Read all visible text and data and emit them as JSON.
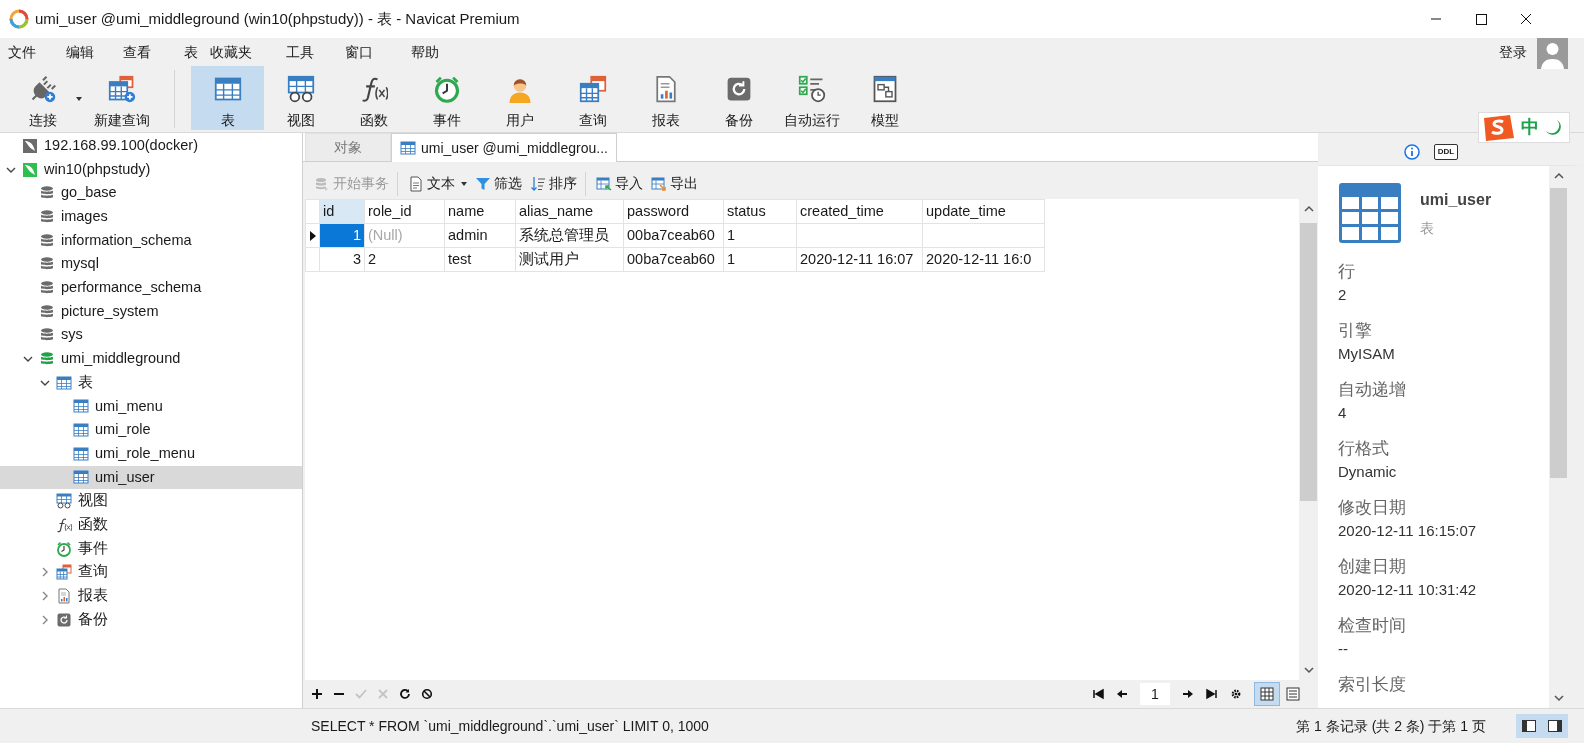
{
  "window": {
    "title": "umi_user @umi_middleground (win10(phpstudy)) - 表 - Navicat Premium"
  },
  "menu": [
    "文件",
    "编辑",
    "查看",
    "表",
    "收藏夹",
    "工具",
    "窗口",
    "帮助"
  ],
  "account": {
    "label": "登录"
  },
  "toolbar": [
    {
      "kind": "connect",
      "label": "连接",
      "selected": false,
      "dropdown": true
    },
    {
      "kind": "new-query",
      "label": "新建查询",
      "selected": false,
      "dropdown": false
    },
    {
      "kind": "table",
      "label": "表",
      "selected": true,
      "dropdown": false
    },
    {
      "kind": "view",
      "label": "视图",
      "selected": false,
      "dropdown": false
    },
    {
      "kind": "function",
      "label": "函数",
      "selected": false,
      "dropdown": false
    },
    {
      "kind": "event",
      "label": "事件",
      "selected": false,
      "dropdown": false
    },
    {
      "kind": "user",
      "label": "用户",
      "selected": false,
      "dropdown": false
    },
    {
      "kind": "query",
      "label": "查询",
      "selected": false,
      "dropdown": false
    },
    {
      "kind": "report",
      "label": "报表",
      "selected": false,
      "dropdown": false
    },
    {
      "kind": "backup",
      "label": "备份",
      "selected": false,
      "dropdown": false
    },
    {
      "kind": "autorun",
      "label": "自动运行",
      "selected": false,
      "dropdown": false
    },
    {
      "kind": "model",
      "label": "模型",
      "selected": false,
      "dropdown": false
    }
  ],
  "tree": [
    {
      "kind": "connection",
      "label": "192.168.99.100(docker)",
      "open": false,
      "selected": false
    },
    {
      "kind": "connection",
      "label": "win10(phpstudy)",
      "open": true,
      "expanded": true,
      "selected": false,
      "children": [
        {
          "kind": "database",
          "label": "go_base",
          "open": false,
          "selected": false
        },
        {
          "kind": "database",
          "label": "images",
          "open": false,
          "selected": false
        },
        {
          "kind": "database",
          "label": "information_schema",
          "open": false,
          "selected": false
        },
        {
          "kind": "database",
          "label": "mysql",
          "open": false,
          "selected": false
        },
        {
          "kind": "database",
          "label": "performance_schema",
          "open": false,
          "selected": false
        },
        {
          "kind": "database",
          "label": "picture_system",
          "open": false,
          "selected": false
        },
        {
          "kind": "database",
          "label": "sys",
          "open": false,
          "selected": false
        },
        {
          "kind": "database",
          "label": "umi_middleground",
          "open": true,
          "expanded": true,
          "selected": false,
          "children": [
            {
              "kind": "table",
              "label": "表",
              "expanded": true,
              "selected": false,
              "children": [
                {
                  "kind": "table",
                  "label": "umi_menu",
                  "selected": false
                },
                {
                  "kind": "table",
                  "label": "umi_role",
                  "selected": false
                },
                {
                  "kind": "table",
                  "label": "umi_role_menu",
                  "selected": false
                },
                {
                  "kind": "table",
                  "label": "umi_user",
                  "selected": true
                }
              ]
            },
            {
              "kind": "view",
              "label": "视图",
              "selected": false
            },
            {
              "kind": "function",
              "label": "函数",
              "selected": false
            },
            {
              "kind": "event",
              "label": "事件",
              "selected": false
            },
            {
              "kind": "query",
              "label": "查询",
              "expanded": false,
              "selected": false
            },
            {
              "kind": "report",
              "label": "报表",
              "expanded": false,
              "selected": false
            },
            {
              "kind": "backup",
              "label": "备份",
              "expanded": false,
              "selected": false
            }
          ]
        }
      ]
    }
  ],
  "tabs": [
    {
      "kind": "objects",
      "label": "对象",
      "selected": false
    },
    {
      "kind": "table",
      "label": "umi_user @umi_middlegrou...",
      "selected": true
    }
  ],
  "grid_toolbar": [
    {
      "kind": "transaction",
      "label": "开始事务",
      "disabled": true,
      "separator_after": true,
      "dropdown": false
    },
    {
      "kind": "text",
      "label": "文本",
      "disabled": false,
      "separator_after": false,
      "dropdown": true
    },
    {
      "kind": "filter",
      "label": "筛选",
      "disabled": false,
      "separator_after": false,
      "dropdown": false
    },
    {
      "kind": "sort",
      "label": "排序",
      "disabled": false,
      "separator_after": true,
      "dropdown": false
    },
    {
      "kind": "import",
      "label": "导入",
      "disabled": false,
      "separator_after": false,
      "dropdown": false
    },
    {
      "kind": "export",
      "label": "导出",
      "disabled": false,
      "separator_after": false,
      "dropdown": false
    }
  ],
  "table": {
    "columns": [
      {
        "label": "id",
        "selected": true
      },
      {
        "label": "role_id",
        "selected": false
      },
      {
        "label": "name",
        "selected": false
      },
      {
        "label": "alias_name",
        "selected": false
      },
      {
        "label": "password",
        "selected": false
      },
      {
        "label": "status",
        "selected": false
      },
      {
        "label": "created_time",
        "selected": false
      },
      {
        "label": "update_time",
        "selected": false
      }
    ],
    "rows": [
      {
        "selected": true,
        "cells": [
          {
            "kind": "number",
            "text": "1"
          },
          {
            "kind": "null",
            "text": "(Null)"
          },
          {
            "kind": "text",
            "text": "admin"
          },
          {
            "kind": "text",
            "text": "系统总管理员"
          },
          {
            "kind": "text",
            "text": "00ba7ceab60"
          },
          {
            "kind": "text",
            "text": "1"
          },
          {
            "kind": "empty"
          },
          {
            "kind": "empty"
          }
        ]
      },
      {
        "selected": false,
        "cells": [
          {
            "kind": "number",
            "text": "3"
          },
          {
            "kind": "text",
            "text": "2"
          },
          {
            "kind": "text",
            "text": "test"
          },
          {
            "kind": "text",
            "text": "测试用户"
          },
          {
            "kind": "text",
            "text": "00ba7ceab60"
          },
          {
            "kind": "text",
            "text": "1"
          },
          {
            "kind": "text",
            "text": "2020-12-11 16:07"
          },
          {
            "kind": "text",
            "text": "2020-12-11 16:0"
          }
        ]
      }
    ]
  },
  "record_actions": [
    {
      "kind": "add",
      "disabled": false
    },
    {
      "kind": "delete",
      "disabled": false
    },
    {
      "kind": "apply",
      "disabled": true
    },
    {
      "kind": "discard",
      "disabled": true
    },
    {
      "kind": "refresh",
      "disabled": false
    },
    {
      "kind": "stop",
      "disabled": false
    }
  ],
  "pager": {
    "page": "1"
  },
  "view_modes": [
    {
      "kind": "grid",
      "selected": true
    },
    {
      "kind": "form",
      "selected": false
    }
  ],
  "info_panel": {
    "tabs": [
      {
        "kind": "info",
        "selected": true
      },
      {
        "kind": "ddl",
        "label": "DDL",
        "selected": false
      }
    ],
    "name": "umi_user",
    "type": "表",
    "properties": [
      {
        "label": "行",
        "value": "2"
      },
      {
        "label": "引擎",
        "value": "MyISAM"
      },
      {
        "label": "自动递增",
        "value": "4"
      },
      {
        "label": "行格式",
        "value": "Dynamic"
      },
      {
        "label": "修改日期",
        "value": "2020-12-11 16:15:07"
      },
      {
        "label": "创建日期",
        "value": "2020-12-11 10:31:42"
      },
      {
        "label": "检查时间",
        "value": "--"
      },
      {
        "label": "索引长度"
      }
    ]
  },
  "status_bar": {
    "sql": "SELECT * FROM `umi_middleground`.`umi_user` LIMIT 0, 1000",
    "records": "第 1 条记录 (共 2 条) 于第 1 页",
    "panels": [
      {
        "kind": "left",
        "selected": true
      },
      {
        "kind": "right",
        "selected": true
      }
    ]
  },
  "ime": {
    "mode": "中"
  }
}
